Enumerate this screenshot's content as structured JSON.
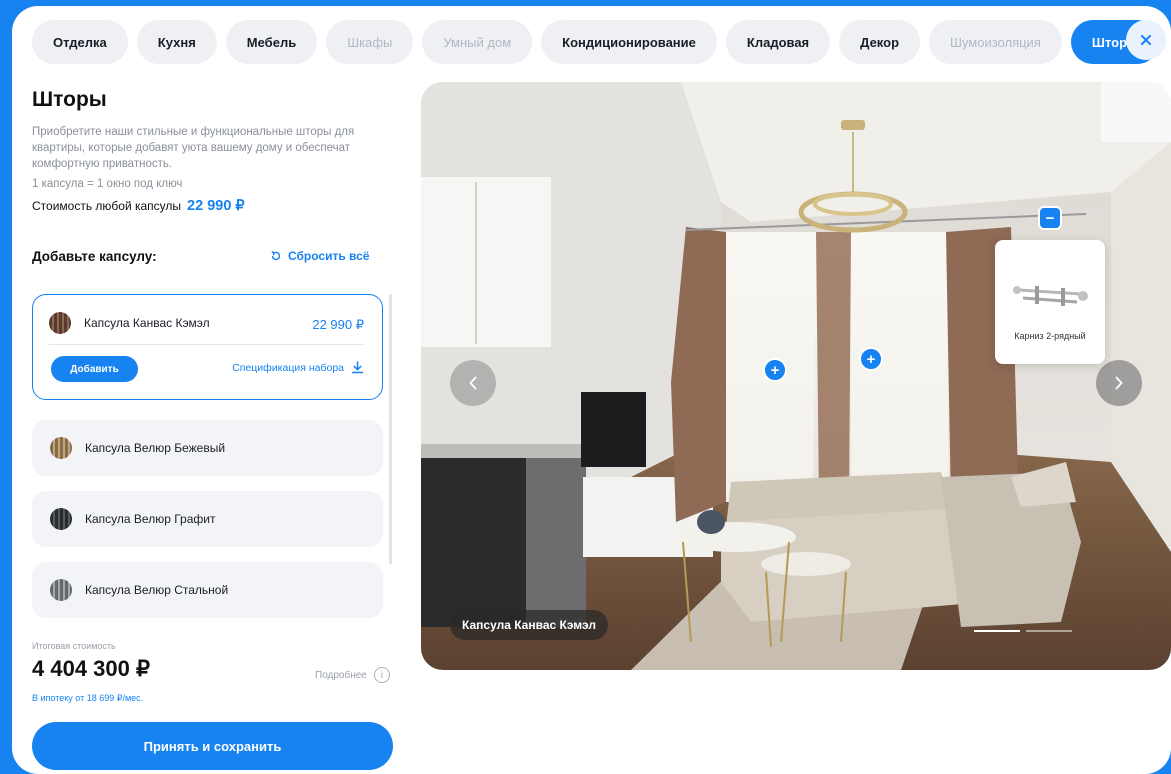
{
  "tabs": [
    {
      "label": "Отделка",
      "state": "normal"
    },
    {
      "label": "Кухня",
      "state": "normal"
    },
    {
      "label": "Мебель",
      "state": "normal"
    },
    {
      "label": "Шкафы",
      "state": "disabled"
    },
    {
      "label": "Умный дом",
      "state": "disabled"
    },
    {
      "label": "Кондиционирование",
      "state": "normal"
    },
    {
      "label": "Кладовая",
      "state": "normal"
    },
    {
      "label": "Декор",
      "state": "normal"
    },
    {
      "label": "Шумоизоляция",
      "state": "disabled"
    },
    {
      "label": "Шторы",
      "state": "active"
    }
  ],
  "panel": {
    "title": "Шторы",
    "description": "Приобретите наши стильные и функциональные шторы для квартиры, которые добавят уюта вашему дому и обеспечат комфортную приватность.",
    "capsule_note": "1 капсула = 1 окно под ключ",
    "price_label": "Стоимость любой капсулы",
    "price_value": "22 990 ₽",
    "add_title": "Добавьте капсулу:",
    "reset_label": "Сбросить всё"
  },
  "capsules": [
    {
      "name": "Капсула Канвас Кэмэл",
      "price": "22 990 ₽",
      "selected": true,
      "add_label": "Добавить",
      "spec_label": "Спецификация набора",
      "swatch": "#6b4a3a"
    },
    {
      "name": "Капсула Велюр Бежевый",
      "swatch": "#a88a66"
    },
    {
      "name": "Капсула Велюр Графит",
      "swatch": "#3a3d40"
    },
    {
      "name": "Капсула Велюр Стальной",
      "swatch": "#808489"
    }
  ],
  "total": {
    "label": "Итоговая стоимость",
    "value": "4 404 300 ₽",
    "more_label": "Подробнее",
    "mortgage": "В ипотеку от 18 699 ₽/мес.",
    "accept_label": "Принять и сохранить"
  },
  "viewer": {
    "caption": "Капсула Канвас Кэмэл",
    "tooltip_label": "Карниз 2-рядный",
    "slides": 2,
    "active_slide": 1
  },
  "colors": {
    "accent": "#1683f0",
    "chip": "#eef0f4",
    "disabled_text": "#b2b7c2"
  }
}
